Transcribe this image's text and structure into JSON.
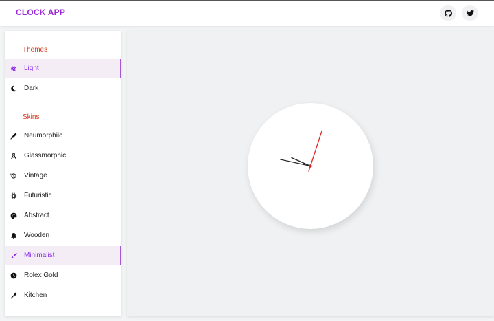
{
  "header": {
    "title": "CLOCK APP",
    "icons": [
      "github-icon",
      "twitter-icon"
    ]
  },
  "sidebar": {
    "themes_title": "Themes",
    "themes": [
      {
        "label": "Light",
        "icon": "gear-icon",
        "active": true
      },
      {
        "label": "Dark",
        "icon": "moon-icon",
        "active": false
      }
    ],
    "skins_title": "Skins",
    "skins": [
      {
        "label": "Neumorphiic",
        "icon": "pen-icon",
        "active": false
      },
      {
        "label": "Glassmorphic",
        "icon": "compass-icon",
        "active": false
      },
      {
        "label": "Vintage",
        "icon": "history-icon",
        "active": false
      },
      {
        "label": "Futuristic",
        "icon": "chip-icon",
        "active": false
      },
      {
        "label": "Abstract",
        "icon": "palette-icon",
        "active": false
      },
      {
        "label": "Wooden",
        "icon": "bell-icon",
        "active": false
      },
      {
        "label": "Minimalist",
        "icon": "brush-icon",
        "active": true
      },
      {
        "label": "Rolex Gold",
        "icon": "clock-icon",
        "active": false
      },
      {
        "label": "Kitchen",
        "icon": "spoon-icon",
        "active": false
      }
    ]
  },
  "colors": {
    "accent": "#9b2bd6",
    "section_title": "#d13a1e",
    "second_hand": "#e02222"
  },
  "clock": {
    "hour": 9,
    "minute": 47,
    "second": 3
  }
}
